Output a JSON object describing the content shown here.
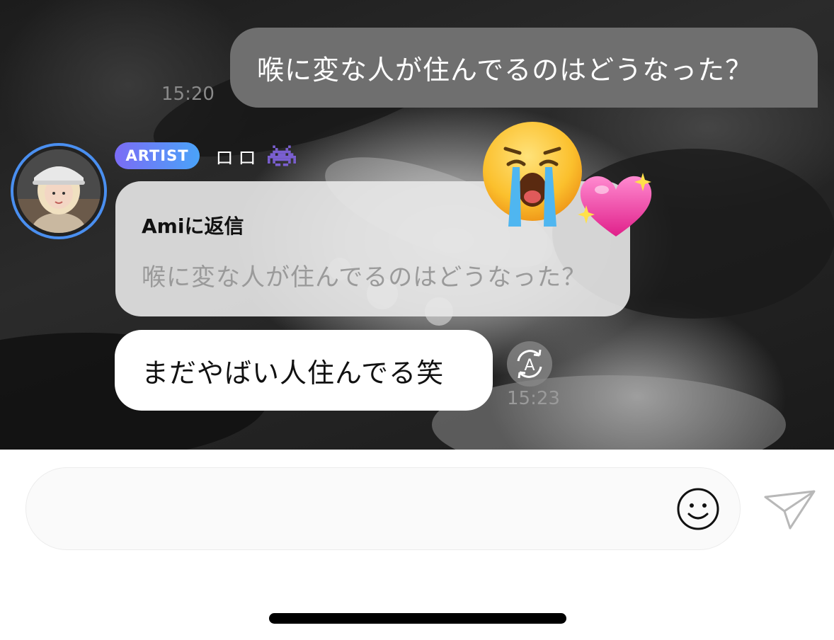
{
  "chat": {
    "outgoing": {
      "text": "喉に変な人が住んでるのはどうなった？",
      "time": "15:20"
    },
    "incoming": {
      "badge": "ARTIST",
      "sender": "ロロ",
      "reply_to": "Amiに返信",
      "quoted_text": "喉に変な人が住んでるのはどうなった？",
      "text": "まだやばい人住んでる笑",
      "time": "15:23",
      "reactions": [
        "crying-face",
        "sparkling-heart"
      ]
    }
  },
  "composer": {
    "placeholder": ""
  },
  "colors": {
    "outgoing_bubble": "#6f6f6f",
    "incoming_bubble": "#ffffff",
    "badge_gradient_start": "#7b6cf6",
    "badge_gradient_end": "#4aa3f8",
    "avatar_ring": "#4a8ff0"
  },
  "icons": {
    "sender_emoji": "alien-monster-icon",
    "translate": "translate-icon",
    "emoji_picker": "smiley-icon",
    "send": "paper-plane-icon"
  }
}
